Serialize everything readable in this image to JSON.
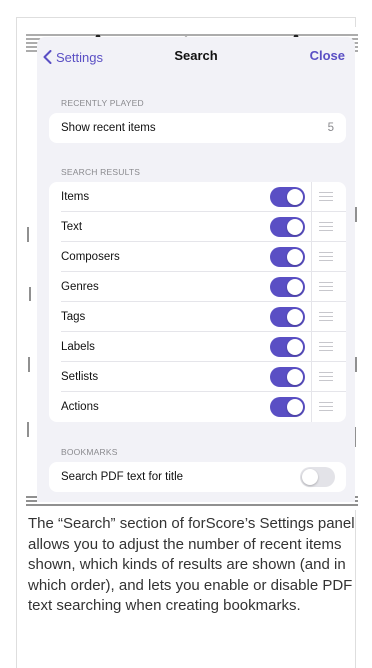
{
  "nav": {
    "back_label": "Settings",
    "title": "Search",
    "close_label": "Close"
  },
  "recently_played": {
    "header": "RECENTLY PLAYED",
    "row_label": "Show recent items",
    "row_value": "5"
  },
  "search_results": {
    "header": "SEARCH RESULTS",
    "items": [
      {
        "label": "Items",
        "on": true
      },
      {
        "label": "Text",
        "on": true
      },
      {
        "label": "Composers",
        "on": true
      },
      {
        "label": "Genres",
        "on": true
      },
      {
        "label": "Tags",
        "on": true
      },
      {
        "label": "Labels",
        "on": true
      },
      {
        "label": "Setlists",
        "on": true
      },
      {
        "label": "Actions",
        "on": true
      }
    ]
  },
  "bookmarks": {
    "header": "BOOKMARKS",
    "row_label": "Search PDF text for title",
    "on": false
  },
  "caption": "The “Search” section of forScore’s Settings panel allows you to adjust the number of recent items shown, which kinds of results are shown (and in which order), and lets you enable or disable PDF text searching when creating bookmarks.",
  "colors": {
    "accent": "#5a4fc4",
    "panel_bg": "#f2f2f7",
    "toggle_off": "#e3e3e8"
  }
}
